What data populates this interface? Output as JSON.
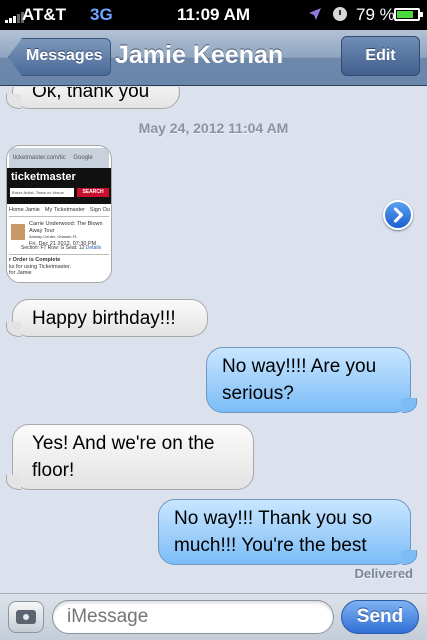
{
  "status_bar": {
    "carrier": "AT&T",
    "network": "3G",
    "time": "11:09 AM",
    "battery_percent": "79 %",
    "battery_level": 0.79,
    "icons": [
      "signal-icon",
      "location-arrow-icon",
      "alarm-icon",
      "battery-icon"
    ]
  },
  "nav": {
    "back_label": "Messages",
    "title": "Jamie Keenan",
    "edit_label": "Edit"
  },
  "conversation": {
    "messages": [
      {
        "direction": "incoming",
        "text": "Ok, thank you"
      },
      {
        "direction": "incoming",
        "type": "image-attachment"
      },
      {
        "direction": "incoming",
        "text": "Happy birthday!!!"
      },
      {
        "direction": "outgoing",
        "text_lines": [
          "No way!!!! Are you",
          "serious?"
        ]
      },
      {
        "direction": "incoming",
        "text_lines": [
          "Yes! And we're on the",
          "floor!"
        ]
      },
      {
        "direction": "outgoing",
        "text_lines": [
          "No way!!! Thank you so",
          "much!!! You're the best"
        ]
      }
    ],
    "timestamp": "May 24, 2012 11:04 AM",
    "delivered": "Delivered",
    "attachment_thumbnail": {
      "address_text": "ticketmaster.com/tic",
      "search_hint": "Google",
      "brand": "ticketmaster",
      "search_placeholder": "Enter Artist, Team or Venue",
      "search_button": "SEARCH",
      "nav_items": [
        "Home Jamie",
        "My Ticketmaster",
        "Sign Ou"
      ],
      "event_title": "Carrie Underwood: The Blown Away Tour",
      "event_venue": "Amway Center, Orlando FL",
      "event_date": "Fri, Dec 21 2012, 07:30 PM",
      "seat_info": "Section: F7 Row: G Seat: 12",
      "details": "Details",
      "order_status": "r Order is Complete",
      "thanks_text": "ks for using Ticketmaster.",
      "for_text": "for Jamie"
    }
  },
  "input_bar": {
    "placeholder": "iMessage",
    "send_label": "Send"
  }
}
